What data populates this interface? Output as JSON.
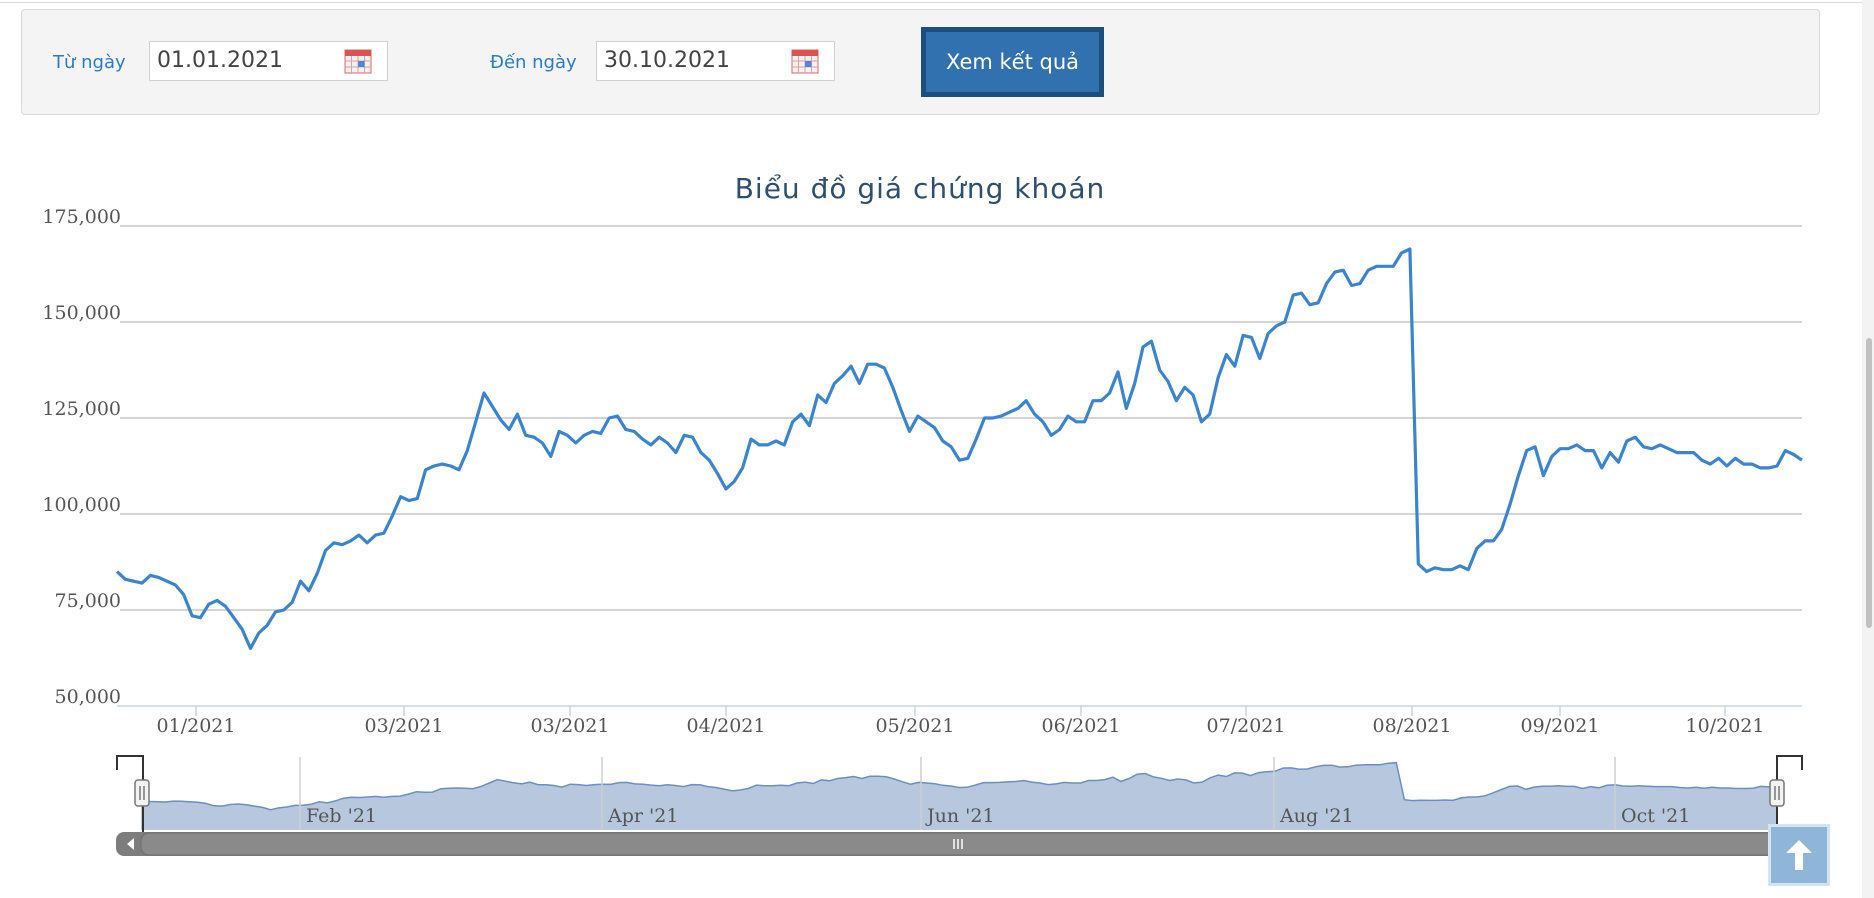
{
  "filter": {
    "from_label": "Từ ngày",
    "from_value": "01.01.2021",
    "to_label": "Đến ngày",
    "to_value": "30.10.2021",
    "submit_label": "Xem kết quả"
  },
  "colors": {
    "accent": "#2a7cc7",
    "button": "#3271b0",
    "line": "#3a84d0",
    "navigator_fill": "#b7c7dd"
  },
  "icons": {
    "calendar": "calendar-icon",
    "scroll_top": "arrow-up-icon"
  },
  "chart_data": {
    "type": "line",
    "title": "Biểu đồ giá chứng khoán",
    "xlabel": "",
    "ylabel": "",
    "ylim": [
      50000,
      175000
    ],
    "yticks": [
      "50,000",
      "75,000",
      "100,000",
      "125,000",
      "150,000",
      "175,000"
    ],
    "xticks": [
      "01/2021",
      "03/2021",
      "03/2021",
      "04/2021",
      "05/2021",
      "06/2021",
      "07/2021",
      "08/2021",
      "09/2021",
      "10/2021"
    ],
    "grid": true,
    "legend": "none",
    "series": [
      {
        "values": [
          85000,
          83000,
          82500,
          82000,
          84000,
          83500,
          82500,
          81500,
          79000,
          73500,
          73000,
          76500,
          77500,
          76000,
          73000,
          70000,
          65000,
          69000,
          71000,
          74500,
          75000,
          77000,
          82500,
          80000,
          84500,
          90500,
          92500,
          92000,
          93000,
          94500,
          92500,
          94500,
          95000,
          99500,
          104500,
          103500,
          104000,
          111500,
          112500,
          113000,
          112500,
          111500,
          116500,
          124000,
          131500,
          128000,
          124500,
          122000,
          126000,
          120500,
          120000,
          118500,
          115000,
          121500,
          120500,
          118500,
          120500,
          121500,
          121000,
          125000,
          125500,
          122000,
          121500,
          119500,
          118000,
          120000,
          118500,
          116000,
          120500,
          120000,
          116000,
          114000,
          110500,
          106500,
          108500,
          112000,
          119500,
          118000,
          118000,
          119000,
          118000,
          124000,
          126000,
          123000,
          131000,
          129000,
          134000,
          136000,
          138500,
          134000,
          139000,
          139000,
          138000,
          133000,
          127000,
          121500,
          125500,
          124000,
          122500,
          119000,
          117500,
          114000,
          114500,
          119500,
          125000,
          125000,
          125500,
          126500,
          127500,
          129500,
          126000,
          124000,
          120500,
          122000,
          125500,
          124000,
          124000,
          129500,
          129500,
          131500,
          137000,
          127500,
          134000,
          143500,
          145000,
          137500,
          134500,
          129500,
          133000,
          131000,
          124000,
          126000,
          135500,
          141500,
          138500,
          146500,
          146000,
          140500,
          147000,
          149000,
          150000,
          157000,
          157500,
          154500,
          155000,
          160000,
          163000,
          163500,
          159500,
          160000,
          163500,
          164500,
          164500,
          164500,
          168000,
          169000,
          87000,
          85000,
          86000,
          85500,
          85500,
          86500,
          85500,
          91000,
          93000,
          93000,
          96000,
          102500,
          110000,
          116500,
          117500,
          110000,
          115000,
          117000,
          117000,
          118000,
          116500,
          116500,
          112000,
          116000,
          113500,
          119000,
          120000,
          117500,
          117000,
          118000,
          117000,
          116000,
          116000,
          116000,
          114000,
          113000,
          114500,
          112500,
          114500,
          113000,
          113000,
          112000,
          112000,
          112500,
          116500,
          115500,
          114000
        ]
      }
    ],
    "navigator": {
      "labels": [
        "Feb '21",
        "Apr '21",
        "Jun '21",
        "Aug '21",
        "Oct '21"
      ]
    }
  }
}
